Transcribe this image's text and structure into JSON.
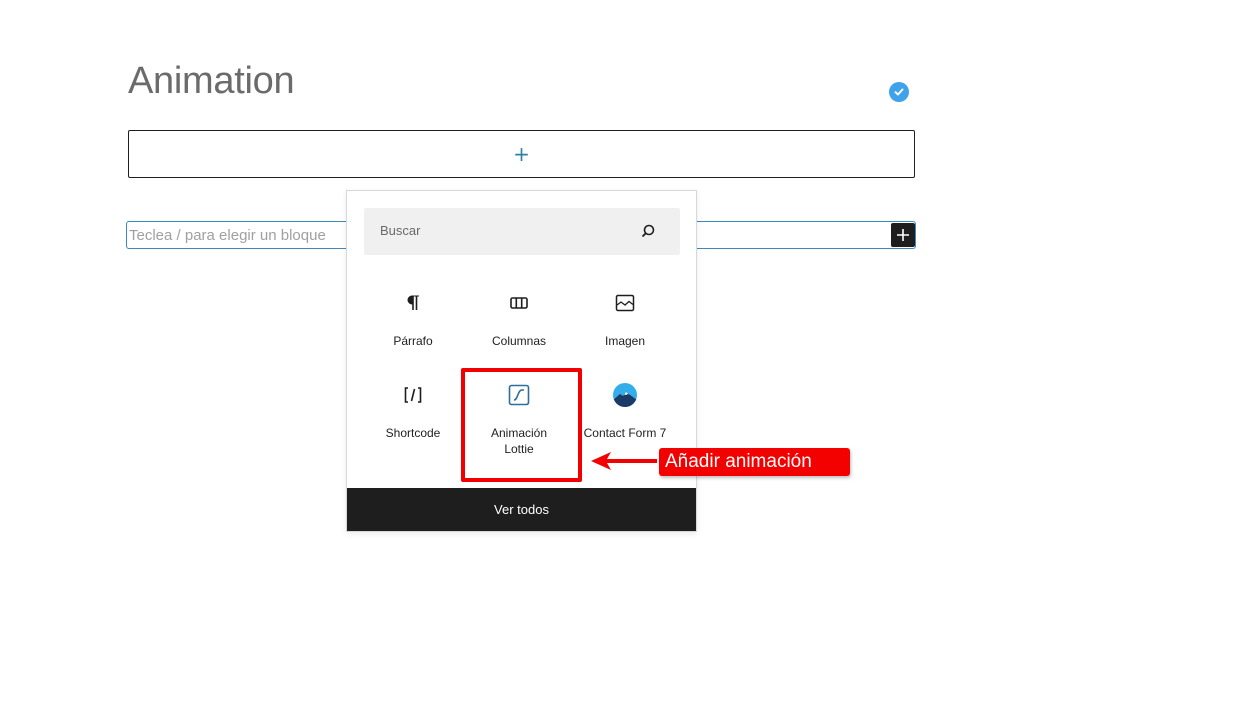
{
  "editor": {
    "post_title": "Animation",
    "paragraph_placeholder": "Teclea / para elegir un bloque",
    "appender_icon": "plus-icon",
    "saved_icon": "check-circle-icon"
  },
  "inserter": {
    "search_placeholder": "Buscar",
    "search_icon": "search-icon",
    "blocks": [
      {
        "label": "Párrafo",
        "icon": "paragraph-icon"
      },
      {
        "label": "Columnas",
        "icon": "columns-icon"
      },
      {
        "label": "Imagen",
        "icon": "image-icon"
      },
      {
        "label": "Shortcode",
        "icon": "shortcode-icon"
      },
      {
        "label_line1": "Animación",
        "label_line2": "Lottie",
        "icon": "lottie-icon"
      },
      {
        "label": "Contact Form 7",
        "icon": "contact-form-icon"
      }
    ],
    "view_all_label": "Ver todos"
  },
  "annotation": {
    "callout_text": "Añadir animación",
    "color": "#f30000"
  },
  "colors": {
    "accent": "#3a89c0",
    "dark": "#1e1e1e",
    "check": "#3fa2ea"
  }
}
